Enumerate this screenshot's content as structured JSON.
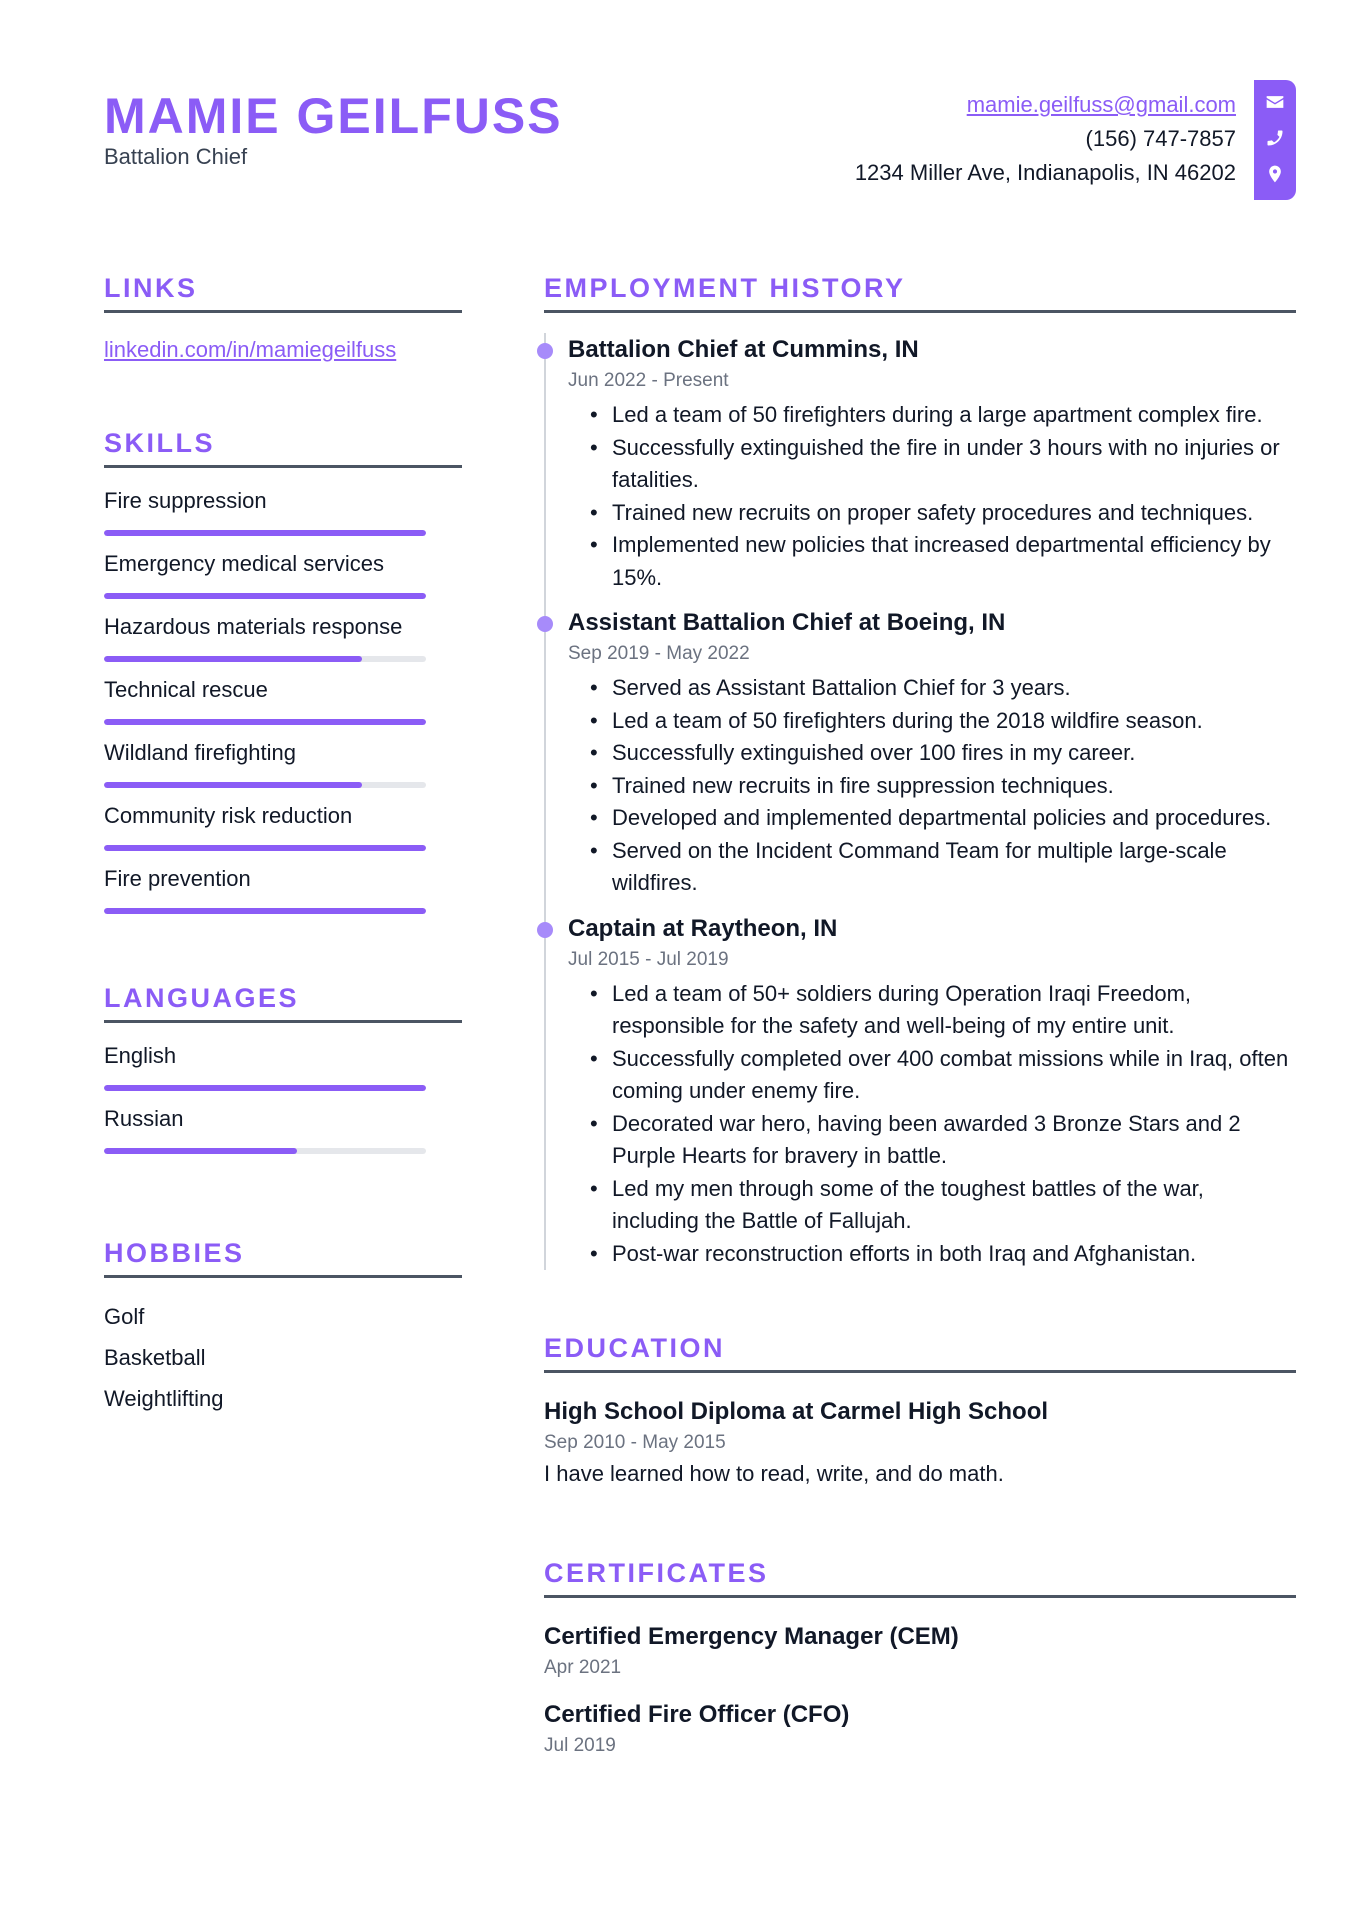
{
  "header": {
    "name": "MAMIE GEILFUSS",
    "title": "Battalion Chief",
    "email": "mamie.geilfuss@gmail.com",
    "phone": "(156) 747-7857",
    "address": "1234 Miller Ave, Indianapolis, IN 46202",
    "icons": [
      "envelope-icon",
      "phone-icon",
      "map-pin-icon"
    ]
  },
  "colors": {
    "accent": "#8b5cf6",
    "dot": "#a78bfa",
    "rule": "#4b5563",
    "track": "#e5e7eb"
  },
  "links": {
    "title": "LINKS",
    "items": [
      {
        "label": "linkedin.com/in/mamiegeilfuss"
      }
    ]
  },
  "skills": {
    "title": "SKILLS",
    "items": [
      {
        "label": "Fire suppression",
        "level": 100
      },
      {
        "label": "Emergency medical services",
        "level": 100
      },
      {
        "label": "Hazardous materials response",
        "level": 80
      },
      {
        "label": "Technical rescue",
        "level": 100
      },
      {
        "label": "Wildland firefighting",
        "level": 80
      },
      {
        "label": "Community risk reduction",
        "level": 100
      },
      {
        "label": "Fire prevention",
        "level": 100
      }
    ]
  },
  "languages": {
    "title": "LANGUAGES",
    "items": [
      {
        "label": "English",
        "level": 100
      },
      {
        "label": "Russian",
        "level": 60
      }
    ]
  },
  "hobbies": {
    "title": "HOBBIES",
    "items": [
      "Golf",
      "Basketball",
      "Weightlifting"
    ]
  },
  "employment": {
    "title": "EMPLOYMENT HISTORY",
    "jobs": [
      {
        "title": "Battalion Chief at Cummins, IN",
        "date": "Jun 2022 - Present",
        "bullets": [
          "Led a team of 50 firefighters during a large apartment complex fire.",
          "Successfully extinguished the fire in under 3 hours with no injuries or fatalities.",
          "Trained new recruits on proper safety procedures and techniques.",
          "Implemented new policies that increased departmental efficiency by 15%."
        ]
      },
      {
        "title": "Assistant Battalion Chief at Boeing, IN",
        "date": "Sep 2019 - May 2022",
        "bullets": [
          "Served as Assistant Battalion Chief for 3 years.",
          "Led a team of 50 firefighters during the 2018 wildfire season.",
          "Successfully extinguished over 100 fires in my career.",
          "Trained new recruits in fire suppression techniques.",
          "Developed and implemented departmental policies and procedures.",
          "Served on the Incident Command Team for multiple large-scale wildfires."
        ]
      },
      {
        "title": "Captain at Raytheon, IN",
        "date": "Jul 2015 - Jul 2019",
        "bullets": [
          "Led a team of 50+ soldiers during Operation Iraqi Freedom, responsible for the safety and well-being of my entire unit.",
          "Successfully completed over 400 combat missions while in Iraq, often coming under enemy fire.",
          "Decorated war hero, having been awarded 3 Bronze Stars and 2 Purple Hearts for bravery in battle.",
          "Led my men through some of the toughest battles of the war, including the Battle of Fallujah.",
          "Post-war reconstruction efforts in both Iraq and Afghanistan."
        ]
      }
    ]
  },
  "education": {
    "title": "EDUCATION",
    "items": [
      {
        "title": "High School Diploma at Carmel High School",
        "date": "Sep 2010 - May 2015",
        "description": "I have learned how to read, write, and do math."
      }
    ]
  },
  "certificates": {
    "title": "CERTIFICATES",
    "items": [
      {
        "title": "Certified Emergency Manager (CEM)",
        "date": "Apr 2021"
      },
      {
        "title": "Certified Fire Officer (CFO)",
        "date": "Jul 2019"
      }
    ]
  }
}
